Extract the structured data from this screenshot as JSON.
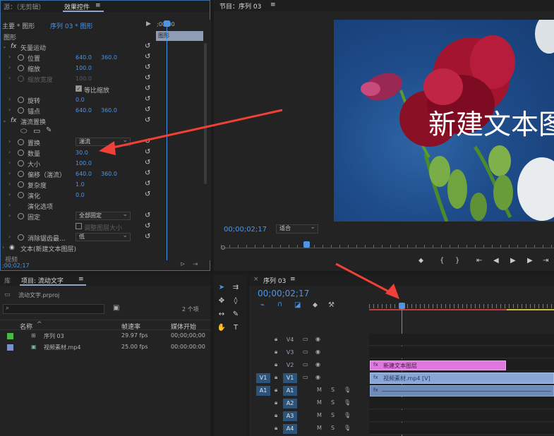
{
  "source": {
    "tab_source": "源：（无剪辑）",
    "tab_effect_controls": "效果控件",
    "menu": "≡"
  },
  "effect_controls": {
    "master_label": "主要 * 图形",
    "sequence_label": "序列 03 * 图形",
    "ruler_timecode": ";00;00",
    "clip_name": "图形",
    "section_label": "图形",
    "rows": [
      {
        "fx": "fx",
        "label": "矢量运动",
        "type": "group"
      },
      {
        "label": "位置",
        "v1": "640.0",
        "v2": "360.0"
      },
      {
        "label": "缩放",
        "v1": "100.0"
      },
      {
        "label": "缩放宽度",
        "v1": "100.0",
        "disabled": true
      },
      {
        "label": "等比缩放",
        "type": "checkbox",
        "checked": true
      },
      {
        "label": "旋转",
        "v1": "0.0"
      },
      {
        "label": "锚点",
        "v1": "640.0",
        "v2": "360.0"
      },
      {
        "fx": "fx",
        "label": "湍流置换",
        "type": "group"
      },
      {
        "type": "masks"
      },
      {
        "label": "置换",
        "dropdown": "湍流"
      },
      {
        "label": "数量",
        "v1": "30.0"
      },
      {
        "label": "大小",
        "v1": "100.0"
      },
      {
        "label": "偏移（湍流）",
        "v1": "640.0",
        "v2": "360.0"
      },
      {
        "label": "复杂度",
        "v1": "1.0"
      },
      {
        "label": "演化",
        "v1": "0.0"
      },
      {
        "label": "演化选项",
        "type": "sub"
      },
      {
        "label": "固定",
        "dropdown": "全部固定"
      },
      {
        "label": "调整图层大小",
        "type": "checkbox",
        "checked": false,
        "disabled": true
      },
      {
        "label": "消除锯齿最...",
        "dropdown": "低"
      },
      {
        "label": "文本(新建文本图层)",
        "type": "text-layer"
      },
      {
        "label": "视频",
        "type": "footer"
      }
    ],
    "bottom_timecode": ";00;02;17"
  },
  "program": {
    "tab_title": "节目：序列 03",
    "menu": "≡",
    "overlay_text": "新建文本图",
    "timecode": "00;00;02;17",
    "fit_label": "适合"
  },
  "project": {
    "tab_library": "库",
    "tab_project": "项目: 流动文字",
    "menu": "≡",
    "proj_file": "流动文字.prproj",
    "item_count": "2 个项",
    "columns": [
      "名称",
      "帧速率",
      "媒体开始"
    ],
    "items": [
      {
        "name": "序列 03",
        "fps": "29.97 fps",
        "start": "00;00;00;00",
        "color": "#4cb84c"
      },
      {
        "name": "视频素材.mp4",
        "fps": "25.00 fps",
        "start": "00:00:00:00",
        "color": "#7b8fc9"
      }
    ]
  },
  "timeline": {
    "tab_title": "序列 03",
    "menu": "≡",
    "timecode": "00;00;02;17",
    "tracks": [
      {
        "name": "V4"
      },
      {
        "name": "V3"
      },
      {
        "name": "V2"
      },
      {
        "name": "V1",
        "src": "V1"
      },
      {
        "name": "A1",
        "src": "A1"
      },
      {
        "name": "A2"
      },
      {
        "name": "A3"
      },
      {
        "name": "A4"
      }
    ],
    "clip_text": "新建文本图层",
    "clip_video": "视频素材.mp4 [V]"
  }
}
